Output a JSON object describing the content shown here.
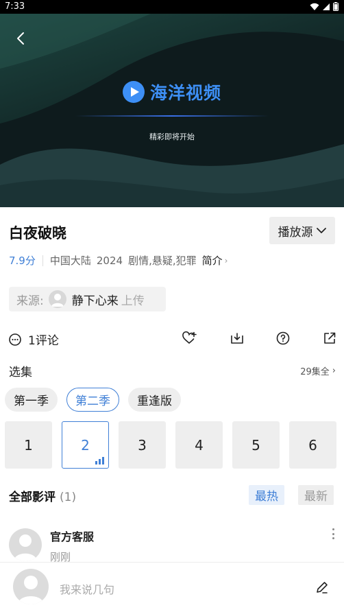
{
  "status_bar": {
    "time": "7:33"
  },
  "player": {
    "brand_name": "海洋视频",
    "loading_text": "精彩即将开始"
  },
  "video": {
    "title": "白夜破晓",
    "source_button": "播放源",
    "score": "7.9分",
    "region": "中国大陆",
    "year": "2024",
    "genres": "剧情,悬疑,犯罪",
    "intro_label": "简介"
  },
  "uploader": {
    "source_label": "来源:",
    "name": "静下心来",
    "action": "上传"
  },
  "actions": {
    "comment_count": "1评论",
    "icons": [
      "heart-plus-icon",
      "download-icon",
      "help-icon",
      "share-icon"
    ]
  },
  "episodes_section": {
    "label": "选集",
    "total": "29集全",
    "seasons": [
      {
        "label": "第一季",
        "active": false
      },
      {
        "label": "第二季",
        "active": true
      },
      {
        "label": "重逢版",
        "active": false
      }
    ],
    "episodes": [
      {
        "label": "1",
        "active": false
      },
      {
        "label": "2",
        "active": true
      },
      {
        "label": "3",
        "active": false
      },
      {
        "label": "4",
        "active": false
      },
      {
        "label": "5",
        "active": false
      },
      {
        "label": "6",
        "active": false
      }
    ]
  },
  "reviews": {
    "title": "全部影评",
    "count": "(1)",
    "sort_hot": "最热",
    "sort_new": "最新",
    "items": [
      {
        "name": "官方客服",
        "time": "刚刚"
      }
    ]
  },
  "comment_bar": {
    "placeholder": "我来说几句"
  },
  "colors": {
    "accent": "#3f7fd6",
    "brand": "#3d8ff5"
  }
}
